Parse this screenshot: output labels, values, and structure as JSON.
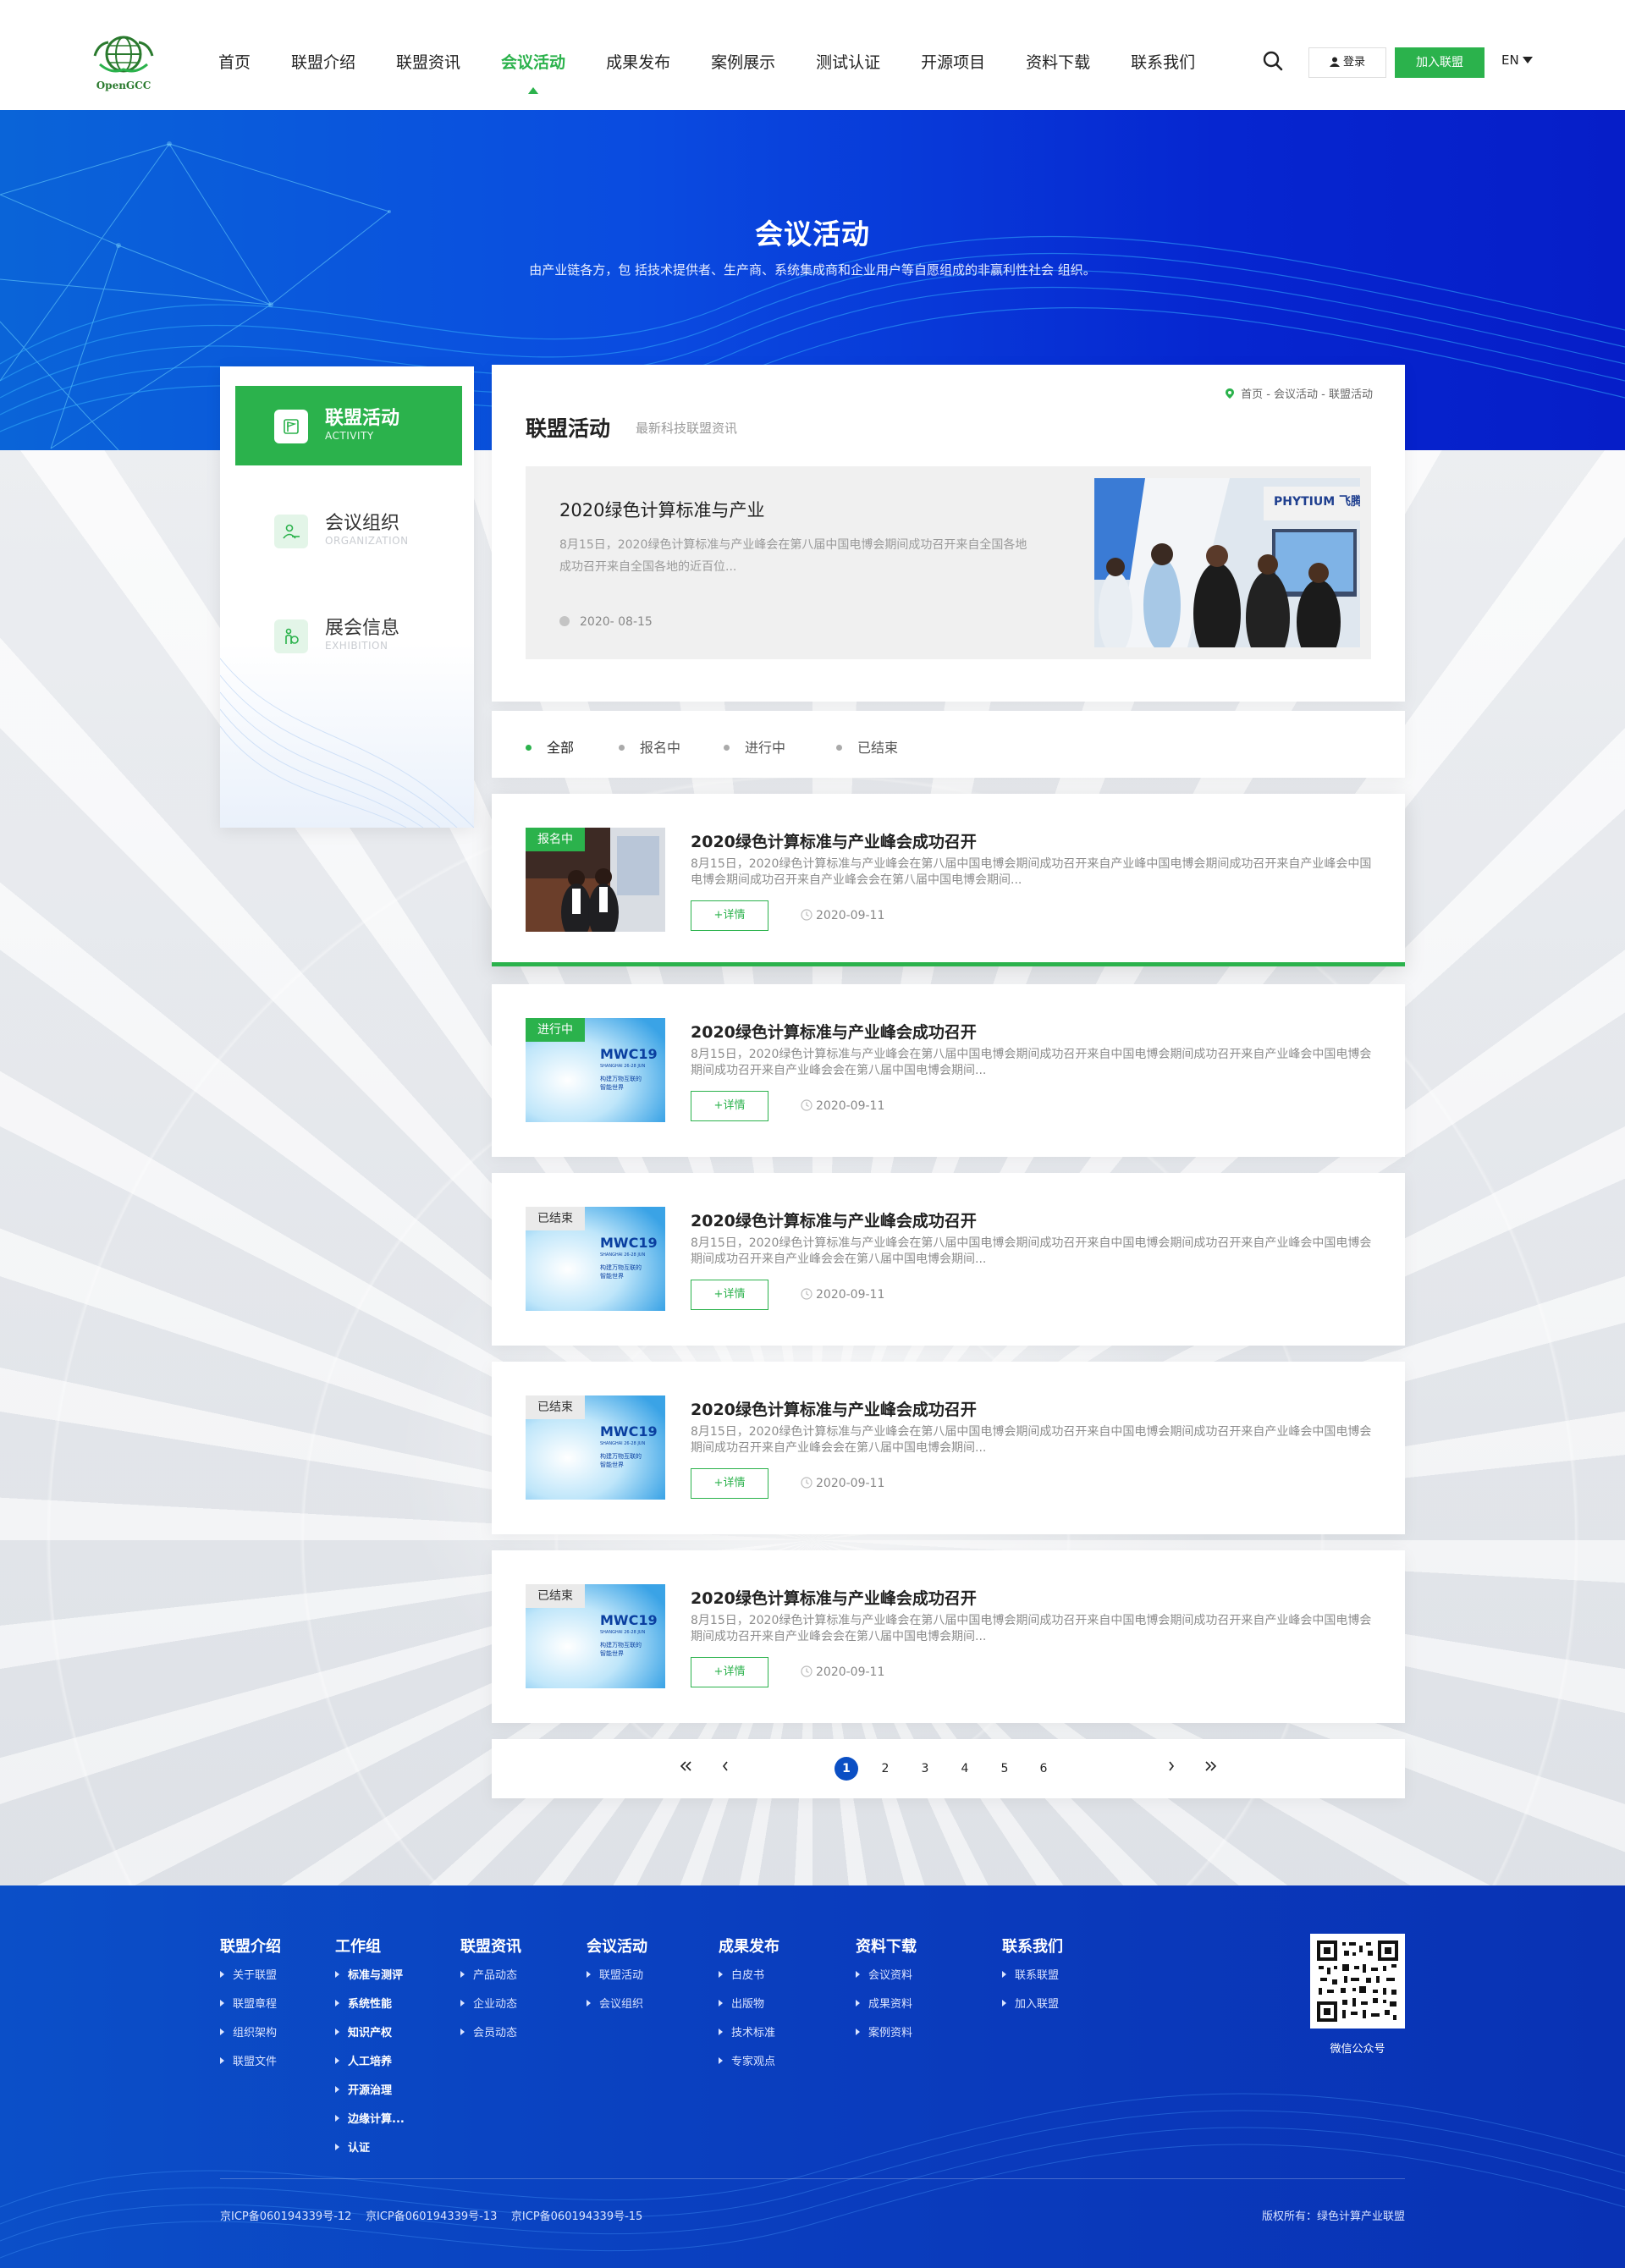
{
  "brand": {
    "logo_text": "OpenGCC",
    "accent": "#2bb24c",
    "primary_blue": "#0b4fc4"
  },
  "nav": {
    "items": [
      "首页",
      "联盟介绍",
      "联盟资讯",
      "会议活动",
      "成果发布",
      "案例展示",
      "测试认证",
      "开源项目",
      "资料下载",
      "联系我们"
    ],
    "active_index": 3
  },
  "header": {
    "search_icon": "search-icon",
    "login_label": "登录",
    "join_label": "加入联盟",
    "lang_label": "EN"
  },
  "banner": {
    "title": "会议活动",
    "subtitle": "由产业链各方，包 括技术提供者、生产商、系统集成商和企业用户等自愿组成的非赢利性社会 组织。"
  },
  "sidebar": {
    "items": [
      {
        "title": "联盟活动",
        "en": "ACTIVITY",
        "icon": "flag-icon",
        "active": true
      },
      {
        "title": "会议组织",
        "en": "ORGANIZATION",
        "icon": "meeting-icon",
        "active": false
      },
      {
        "title": "展会信息",
        "en": "EXHIBITION",
        "icon": "exhibition-icon",
        "active": false
      }
    ]
  },
  "main": {
    "breadcrumb": "首页 - 会议活动 - 联盟活动",
    "section_title": "联盟活动",
    "section_subtitle": "最新科技联盟资讯",
    "feature": {
      "title": "2020绿色计算标准与产业",
      "desc": "8月15日，2020绿色计算标准与产业峰会在第八届中国电博会期间成功召开来自全国各地成功召开来自全国各地的近百位...",
      "date": "2020- 08-15",
      "img_label": "PHYTIUM 飞腾"
    }
  },
  "filters": {
    "items": [
      "全部",
      "报名中",
      "进行中",
      "已结束"
    ],
    "active_index": 0
  },
  "list": [
    {
      "badge": "报名中",
      "status": "open",
      "title": "2020绿色计算标准与产业峰会成功召开",
      "desc": "8月15日，2020绿色计算标准与产业峰会在第八届中国电博会期间成功召开来自产业峰中国电博会期间成功召开来自产业峰会中国电博会期间成功召开来自产业峰会会在第八届中国电博会期间...",
      "detail_label": "+详情",
      "date": "2020-09-11",
      "thumb": "photo"
    },
    {
      "badge": "进行中",
      "status": "ongoing",
      "title": "2020绿色计算标准与产业峰会成功召开",
      "desc": "8月15日，2020绿色计算标准与产业峰会在第八届中国电博会期间成功召开来自中国电博会期间成功召开来自产业峰会中国电博会期间成功召开来自产业峰会会在第八届中国电博会期间...",
      "detail_label": "+详情",
      "date": "2020-09-11",
      "thumb": "mwc"
    },
    {
      "badge": "已结束",
      "status": "ended",
      "title": "2020绿色计算标准与产业峰会成功召开",
      "desc": "8月15日，2020绿色计算标准与产业峰会在第八届中国电博会期间成功召开来自中国电博会期间成功召开来自产业峰会中国电博会期间成功召开来自产业峰会会在第八届中国电博会期间...",
      "detail_label": "+详情",
      "date": "2020-09-11",
      "thumb": "mwc"
    },
    {
      "badge": "已结束",
      "status": "ended",
      "title": "2020绿色计算标准与产业峰会成功召开",
      "desc": "8月15日，2020绿色计算标准与产业峰会在第八届中国电博会期间成功召开来自中国电博会期间成功召开来自产业峰会中国电博会期间成功召开来自产业峰会会在第八届中国电博会期间...",
      "detail_label": "+详情",
      "date": "2020-09-11",
      "thumb": "mwc"
    },
    {
      "badge": "已结束",
      "status": "ended",
      "title": "2020绿色计算标准与产业峰会成功召开",
      "desc": "8月15日，2020绿色计算标准与产业峰会在第八届中国电博会期间成功召开来自中国电博会期间成功召开来自产业峰会中国电博会期间成功召开来自产业峰会会在第八届中国电博会期间...",
      "detail_label": "+详情",
      "date": "2020-09-11",
      "thumb": "mwc"
    }
  ],
  "mwc": {
    "title": "MWC19",
    "sub": "SHANGHAI 26-28 JUN",
    "line1": "构建万物互联的",
    "line2": "智能世界"
  },
  "pagination": {
    "pages": [
      "1",
      "2",
      "3",
      "4",
      "5",
      "6"
    ],
    "current": "1",
    "first_icon": "double-chevron-left-icon",
    "prev_icon": "chevron-left-icon",
    "next_icon": "chevron-right-icon",
    "last_icon": "double-chevron-right-icon"
  },
  "footer": {
    "columns": [
      {
        "title": "联盟介绍",
        "links": [
          "关于联盟",
          "联盟章程",
          "组织架构",
          "联盟文件"
        ],
        "bold": false
      },
      {
        "title": "工作组",
        "links": [
          "标准与测评",
          "系统性能",
          "知识产权",
          "人工培养",
          "开源治理",
          "边缘计算...",
          "认证"
        ],
        "bold": true
      },
      {
        "title": "联盟资讯",
        "links": [
          "产品动态",
          "企业动态",
          "会员动态"
        ],
        "bold": false
      },
      {
        "title": "会议活动",
        "links": [
          "联盟活动",
          "会议组织"
        ],
        "bold": false
      },
      {
        "title": "成果发布",
        "links": [
          "白皮书",
          "出版物",
          "技术标准",
          "专家观点"
        ],
        "bold": false
      },
      {
        "title": "资料下载",
        "links": [
          "会议资料",
          "成果资料",
          "案例资料"
        ],
        "bold": false
      },
      {
        "title": "联系我们",
        "links": [
          "联系联盟",
          "加入联盟"
        ],
        "bold": false
      }
    ],
    "qr_label": "微信公众号",
    "icp": "京ICP备060194339号-12    京ICP备060194339号-13    京ICP备060194339号-15",
    "copyright": "版权所有：绿色计算产业联盟"
  }
}
